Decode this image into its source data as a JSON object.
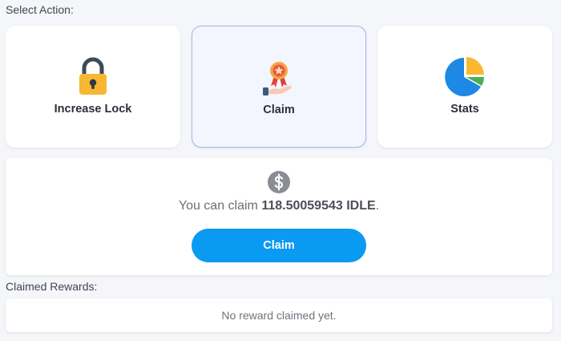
{
  "select_action_label": "Select Action:",
  "actions": [
    {
      "label": "Increase Lock",
      "icon": "padlock-icon",
      "selected": false
    },
    {
      "label": "Claim",
      "icon": "award-ribbon-hand-icon",
      "selected": true
    },
    {
      "label": "Stats",
      "icon": "pie-chart-icon",
      "selected": false
    }
  ],
  "claim_panel": {
    "icon": "dollar-coin-icon",
    "text_prefix": "You can claim ",
    "amount": "118.50059543 IDLE",
    "text_suffix": ".",
    "button_label": "Claim"
  },
  "claimed_rewards": {
    "label": "Claimed Rewards:",
    "empty_text": "No reward claimed yet."
  },
  "colors": {
    "accent": "#0a9af2",
    "lock_body": "#f7b633",
    "pie_blue": "#1e88e5",
    "pie_yellow": "#f9b82f",
    "pie_green": "#4caf50"
  }
}
